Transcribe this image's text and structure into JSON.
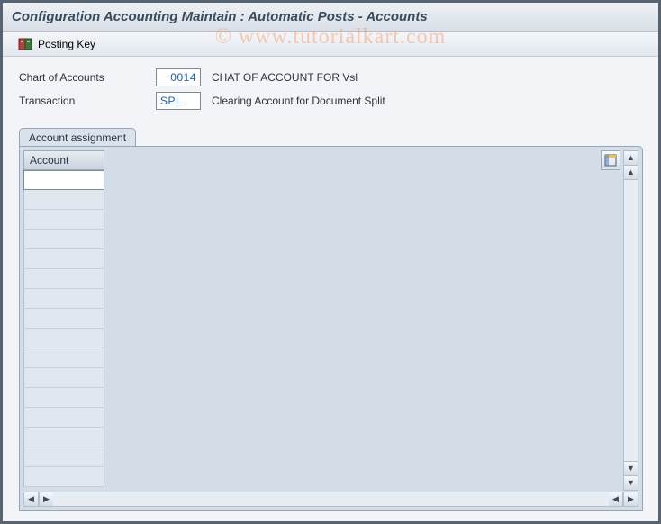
{
  "window": {
    "title": "Configuration Accounting Maintain : Automatic Posts - Accounts"
  },
  "toolbar": {
    "posting_key_label": "Posting Key"
  },
  "fields": {
    "chart_of_accounts": {
      "label": "Chart of Accounts",
      "value": "0014",
      "description": "CHAT OF ACCOUNT FOR Vsl"
    },
    "transaction": {
      "label": "Transaction",
      "value": "SPL",
      "description": "Clearing Account for Document Split"
    }
  },
  "panel": {
    "title": "Account assignment",
    "grid": {
      "columns": [
        {
          "header": "Account"
        }
      ],
      "rows": [
        "",
        "",
        "",
        "",
        "",
        "",
        "",
        "",
        "",
        "",
        "",
        "",
        "",
        "",
        "",
        ""
      ]
    }
  },
  "watermark": "© www.tutorialkart.com",
  "icons": {
    "posting_key": "posting-key-icon",
    "table_config": "table-config-icon"
  }
}
